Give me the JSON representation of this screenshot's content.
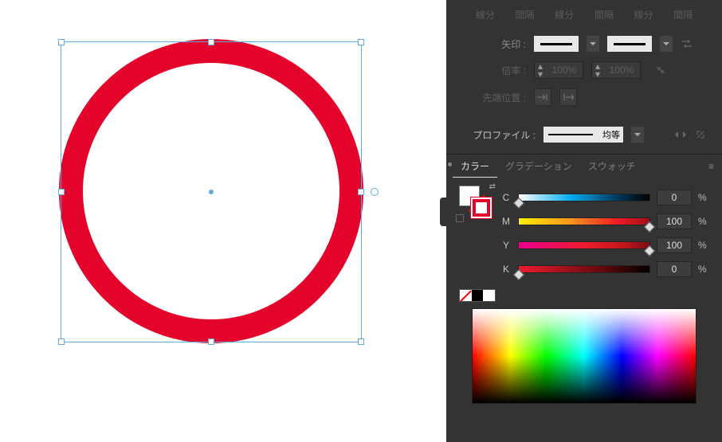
{
  "stroke_panel": {
    "dash_headers": [
      "線分",
      "間隔",
      "線分",
      "間隔",
      "線分",
      "間隔"
    ],
    "arrow_label": "矢印 :",
    "scale_label": "倍率 :",
    "scale_left": "100%",
    "scale_right": "100%",
    "tip_label": "先端位置 :",
    "profile_label": "プロファイル :",
    "profile_value": "均等"
  },
  "tabs": {
    "color": "カラー",
    "gradient": "グラデーション",
    "swatches": "スウォッチ"
  },
  "color": {
    "channels": [
      {
        "label": "C",
        "value": "0",
        "pos": 0,
        "track": "tr-c"
      },
      {
        "label": "M",
        "value": "100",
        "pos": 100,
        "track": "tr-m"
      },
      {
        "label": "Y",
        "value": "100",
        "pos": 100,
        "track": "tr-y"
      },
      {
        "label": "K",
        "value": "0",
        "pos": 0,
        "track": "tr-k"
      }
    ],
    "pct": "%"
  }
}
